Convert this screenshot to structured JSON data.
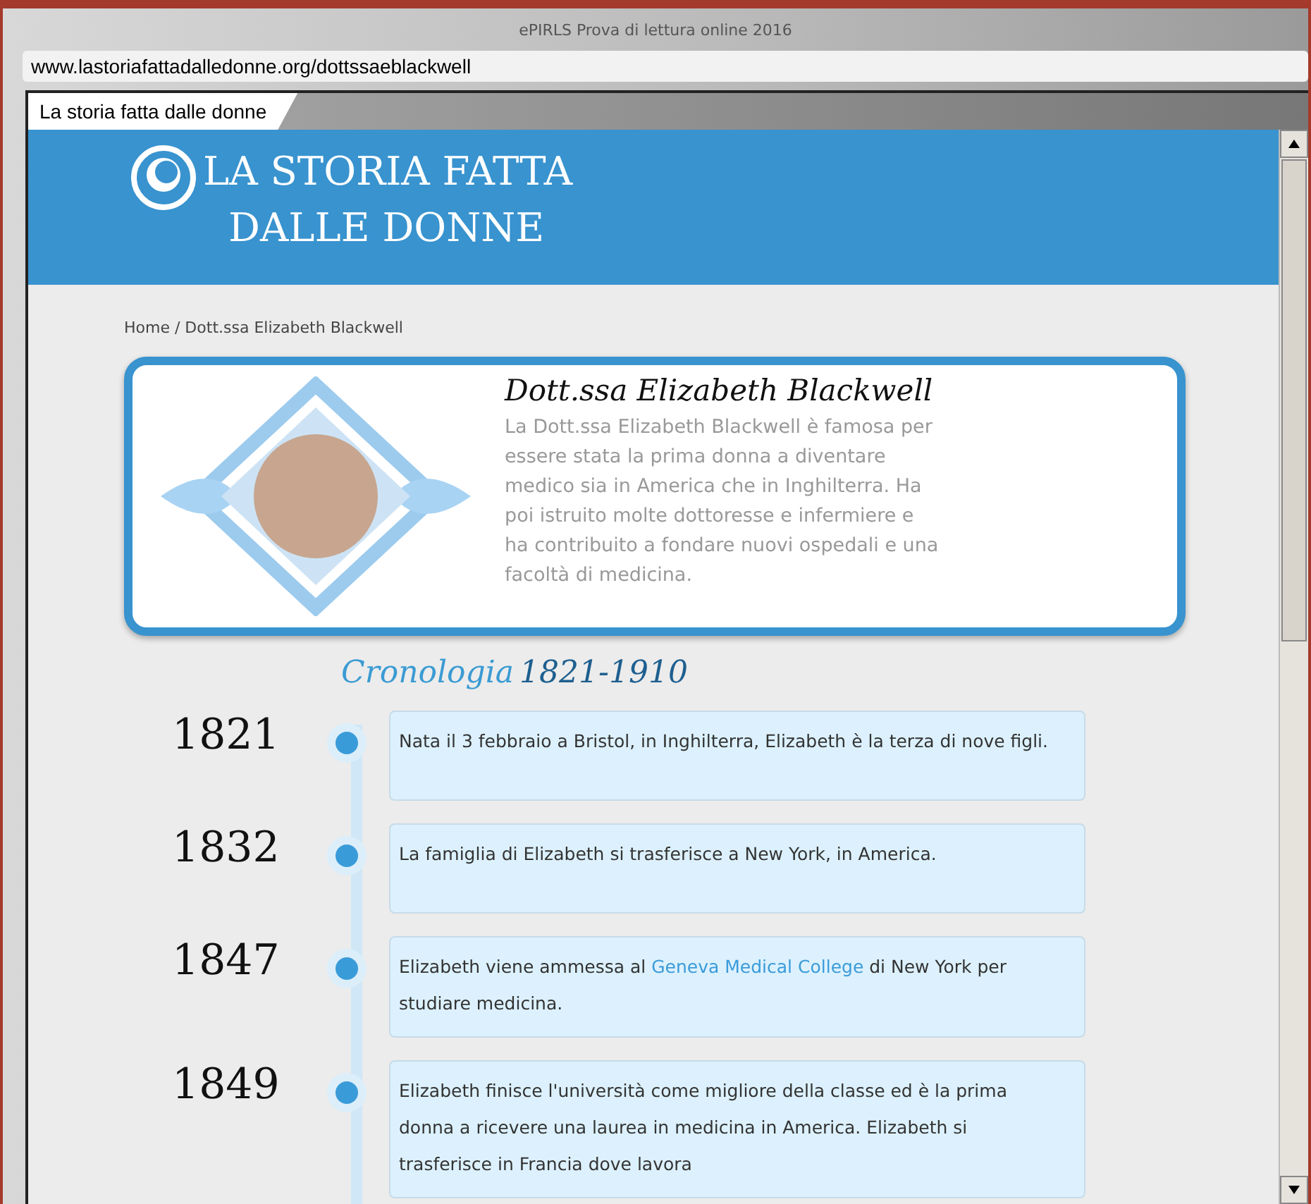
{
  "window": {
    "title": "ePIRLS Prova di lettura online 2016"
  },
  "address_bar": {
    "url": "www.lastoriafattadalledonne.org/dottssaeblackwell"
  },
  "tabs": [
    {
      "label": "La storia fatta dalle donne",
      "selected": true
    }
  ],
  "site": {
    "logo_lines": [
      "LA STORIA FATTA",
      "DALLE DONNE"
    ]
  },
  "breadcrumb": "Home / Dott.ssa Elizabeth Blackwell",
  "profile": {
    "name": "Dott.ssa Elizabeth Blackwell",
    "bio": "La Dott.ssa Elizabeth Blackwell è famosa per essere stata la prima donna a diventare medico sia in America che in Inghilterra. Ha poi istruito molte dottoresse e infermiere e ha contribuito a fondare nuovi ospedali e una facoltà di medicina."
  },
  "timeline": {
    "title": "Cronologia",
    "range": "1821-1910",
    "events": [
      {
        "year": "1821",
        "text_before": "Nata il 3 febbraio a Bristol, in Inghilterra, Elizabeth è la terza di nove figli."
      },
      {
        "year": "1832",
        "text_before": "La famiglia di Elizabeth si trasferisce a New York, in America."
      },
      {
        "year": "1847",
        "text_before": "Elizabeth viene ammessa al ",
        "link": "Geneva Medical College",
        "text_after": " di New York per studiare medicina."
      },
      {
        "year": "1849",
        "text_before": "Elizabeth finisce l'università come migliore della classe ed è la prima donna a ricevere una laurea in medicina in America. Elizabeth si trasferisce in Francia dove lavora"
      }
    ]
  }
}
